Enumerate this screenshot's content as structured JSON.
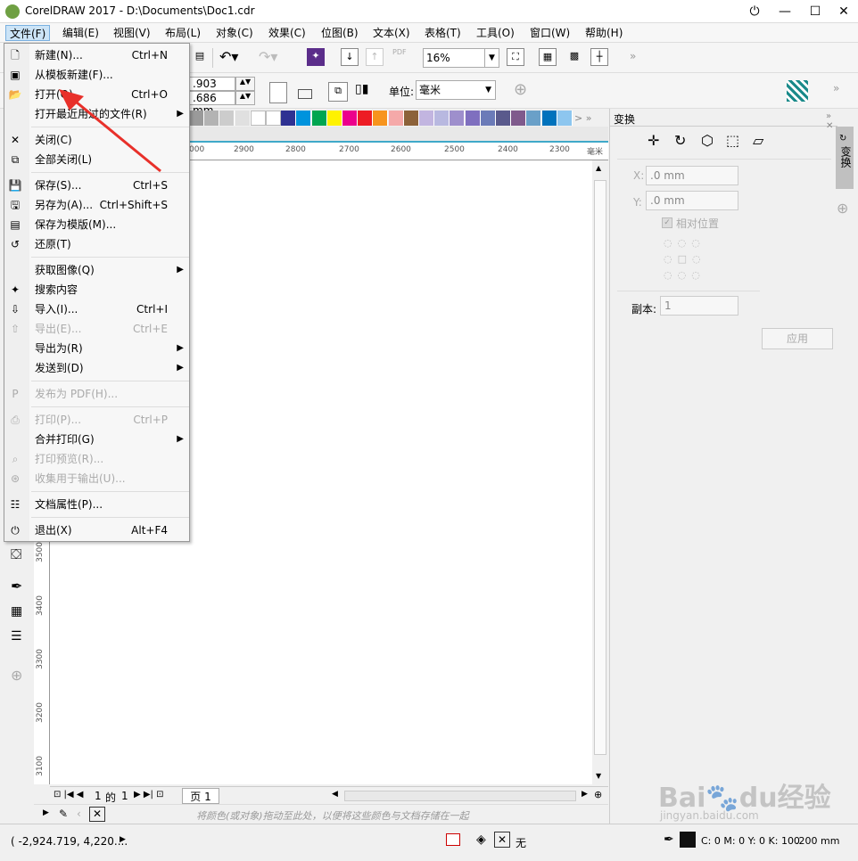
{
  "window": {
    "title": "CorelDRAW 2017 - D:\\Documents\\Doc1.cdr"
  },
  "menubar": {
    "items": [
      "文件(F)",
      "编辑(E)",
      "视图(V)",
      "布局(L)",
      "对象(C)",
      "效果(C)",
      "位图(B)",
      "文本(X)",
      "表格(T)",
      "工具(O)",
      "窗口(W)",
      "帮助(H)"
    ]
  },
  "toolbar": {
    "zoom": "16%",
    "width_field": ".903 mm",
    "height_field": ".686 mm",
    "unit_label": "单位:",
    "unit_value": "毫米"
  },
  "file_menu": {
    "items": [
      {
        "icon": "new-doc-icon",
        "label": "新建(N)...",
        "shortcut": "Ctrl+N"
      },
      {
        "icon": "template-icon",
        "label": "从模板新建(F)...",
        "shortcut": ""
      },
      {
        "icon": "folder-open-icon",
        "label": "打开(O)...",
        "shortcut": "Ctrl+O"
      },
      {
        "icon": "",
        "label": "打开最近用过的文件(R)",
        "shortcut": "",
        "submenu": true
      },
      {
        "icon": "close-doc-icon",
        "label": "关闭(C)",
        "shortcut": ""
      },
      {
        "icon": "close-all-icon",
        "label": "全部关闭(L)",
        "shortcut": ""
      },
      {
        "icon": "save-icon",
        "label": "保存(S)...",
        "shortcut": "Ctrl+S"
      },
      {
        "icon": "save-as-icon",
        "label": "另存为(A)...",
        "shortcut": "Ctrl+Shift+S"
      },
      {
        "icon": "save-template-icon",
        "label": "保存为模版(M)...",
        "shortcut": ""
      },
      {
        "icon": "revert-icon",
        "label": "还原(T)",
        "shortcut": ""
      },
      {
        "icon": "",
        "label": "获取图像(Q)",
        "shortcut": "",
        "submenu": true
      },
      {
        "icon": "search-content-icon",
        "label": "搜索内容",
        "shortcut": ""
      },
      {
        "icon": "import-icon",
        "label": "导入(I)...",
        "shortcut": "Ctrl+I"
      },
      {
        "icon": "export-icon",
        "label": "导出(E)...",
        "shortcut": "Ctrl+E",
        "disabled": true
      },
      {
        "icon": "",
        "label": "导出为(R)",
        "shortcut": "",
        "submenu": true
      },
      {
        "icon": "",
        "label": "发送到(D)",
        "shortcut": "",
        "submenu": true
      },
      {
        "icon": "pdf-icon",
        "label": "发布为 PDF(H)...",
        "shortcut": "",
        "disabled": true
      },
      {
        "icon": "print-icon",
        "label": "打印(P)...",
        "shortcut": "Ctrl+P",
        "disabled": true
      },
      {
        "icon": "",
        "label": "合并打印(G)",
        "shortcut": "",
        "submenu": true
      },
      {
        "icon": "print-preview-icon",
        "label": "打印预览(R)...",
        "shortcut": "",
        "disabled": true
      },
      {
        "icon": "collect-output-icon",
        "label": "收集用于输出(U)...",
        "shortcut": "",
        "disabled": true
      },
      {
        "icon": "doc-properties-icon",
        "label": "文档属性(P)...",
        "shortcut": ""
      },
      {
        "icon": "power-icon",
        "label": "退出(X)",
        "shortcut": "Alt+F4"
      }
    ]
  },
  "ruler": {
    "top_ticks": [
      "000",
      "2900",
      "2800",
      "2700",
      "2600",
      "2500",
      "2400",
      "2300",
      "毫米"
    ],
    "left_ticks": [
      "3500",
      "3400",
      "3300",
      "3200",
      "3100"
    ]
  },
  "palette": {
    "colors": [
      "#9a9a9a",
      "#b3b3b3",
      "#cccccc",
      "#e0e0e0",
      "#ffffff",
      "#ffffff",
      "#2e3192",
      "#0093dd",
      "#00a651",
      "#fff200",
      "#ec008c",
      "#ed1c24",
      "#f7941d",
      "#f5a9a9",
      "#8c6239",
      "#c2b5e0",
      "#b8b8e0",
      "#9e8fcc",
      "#7f6fbf",
      "#6b7bb8",
      "#5a5a8c",
      "#7f5a8c",
      "#6aa0c8",
      "#0072bc",
      "#8dc6ef"
    ]
  },
  "pagebar": {
    "page_index": "1",
    "of_label": "的",
    "page_total": "1",
    "page_tab": "页 1"
  },
  "hint": {
    "text": "将颜色(或对象)拖动至此处，以便将这些颜色与文档存储在一起"
  },
  "status": {
    "coords": "( -2,924.719, 4,220....",
    "fill": "无",
    "outline_color": "C: 0 M: 0 Y: 0 K: 100",
    "outline_width": ".200 mm"
  },
  "docker": {
    "title": "变换",
    "tab_label": "变换",
    "x_label": "X:",
    "x_value": ".0 mm",
    "y_label": "Y:",
    "y_value": ".0 mm",
    "relative_label": "相对位置",
    "copies_label": "副本:",
    "copies_value": "1",
    "apply_label": "应用"
  }
}
